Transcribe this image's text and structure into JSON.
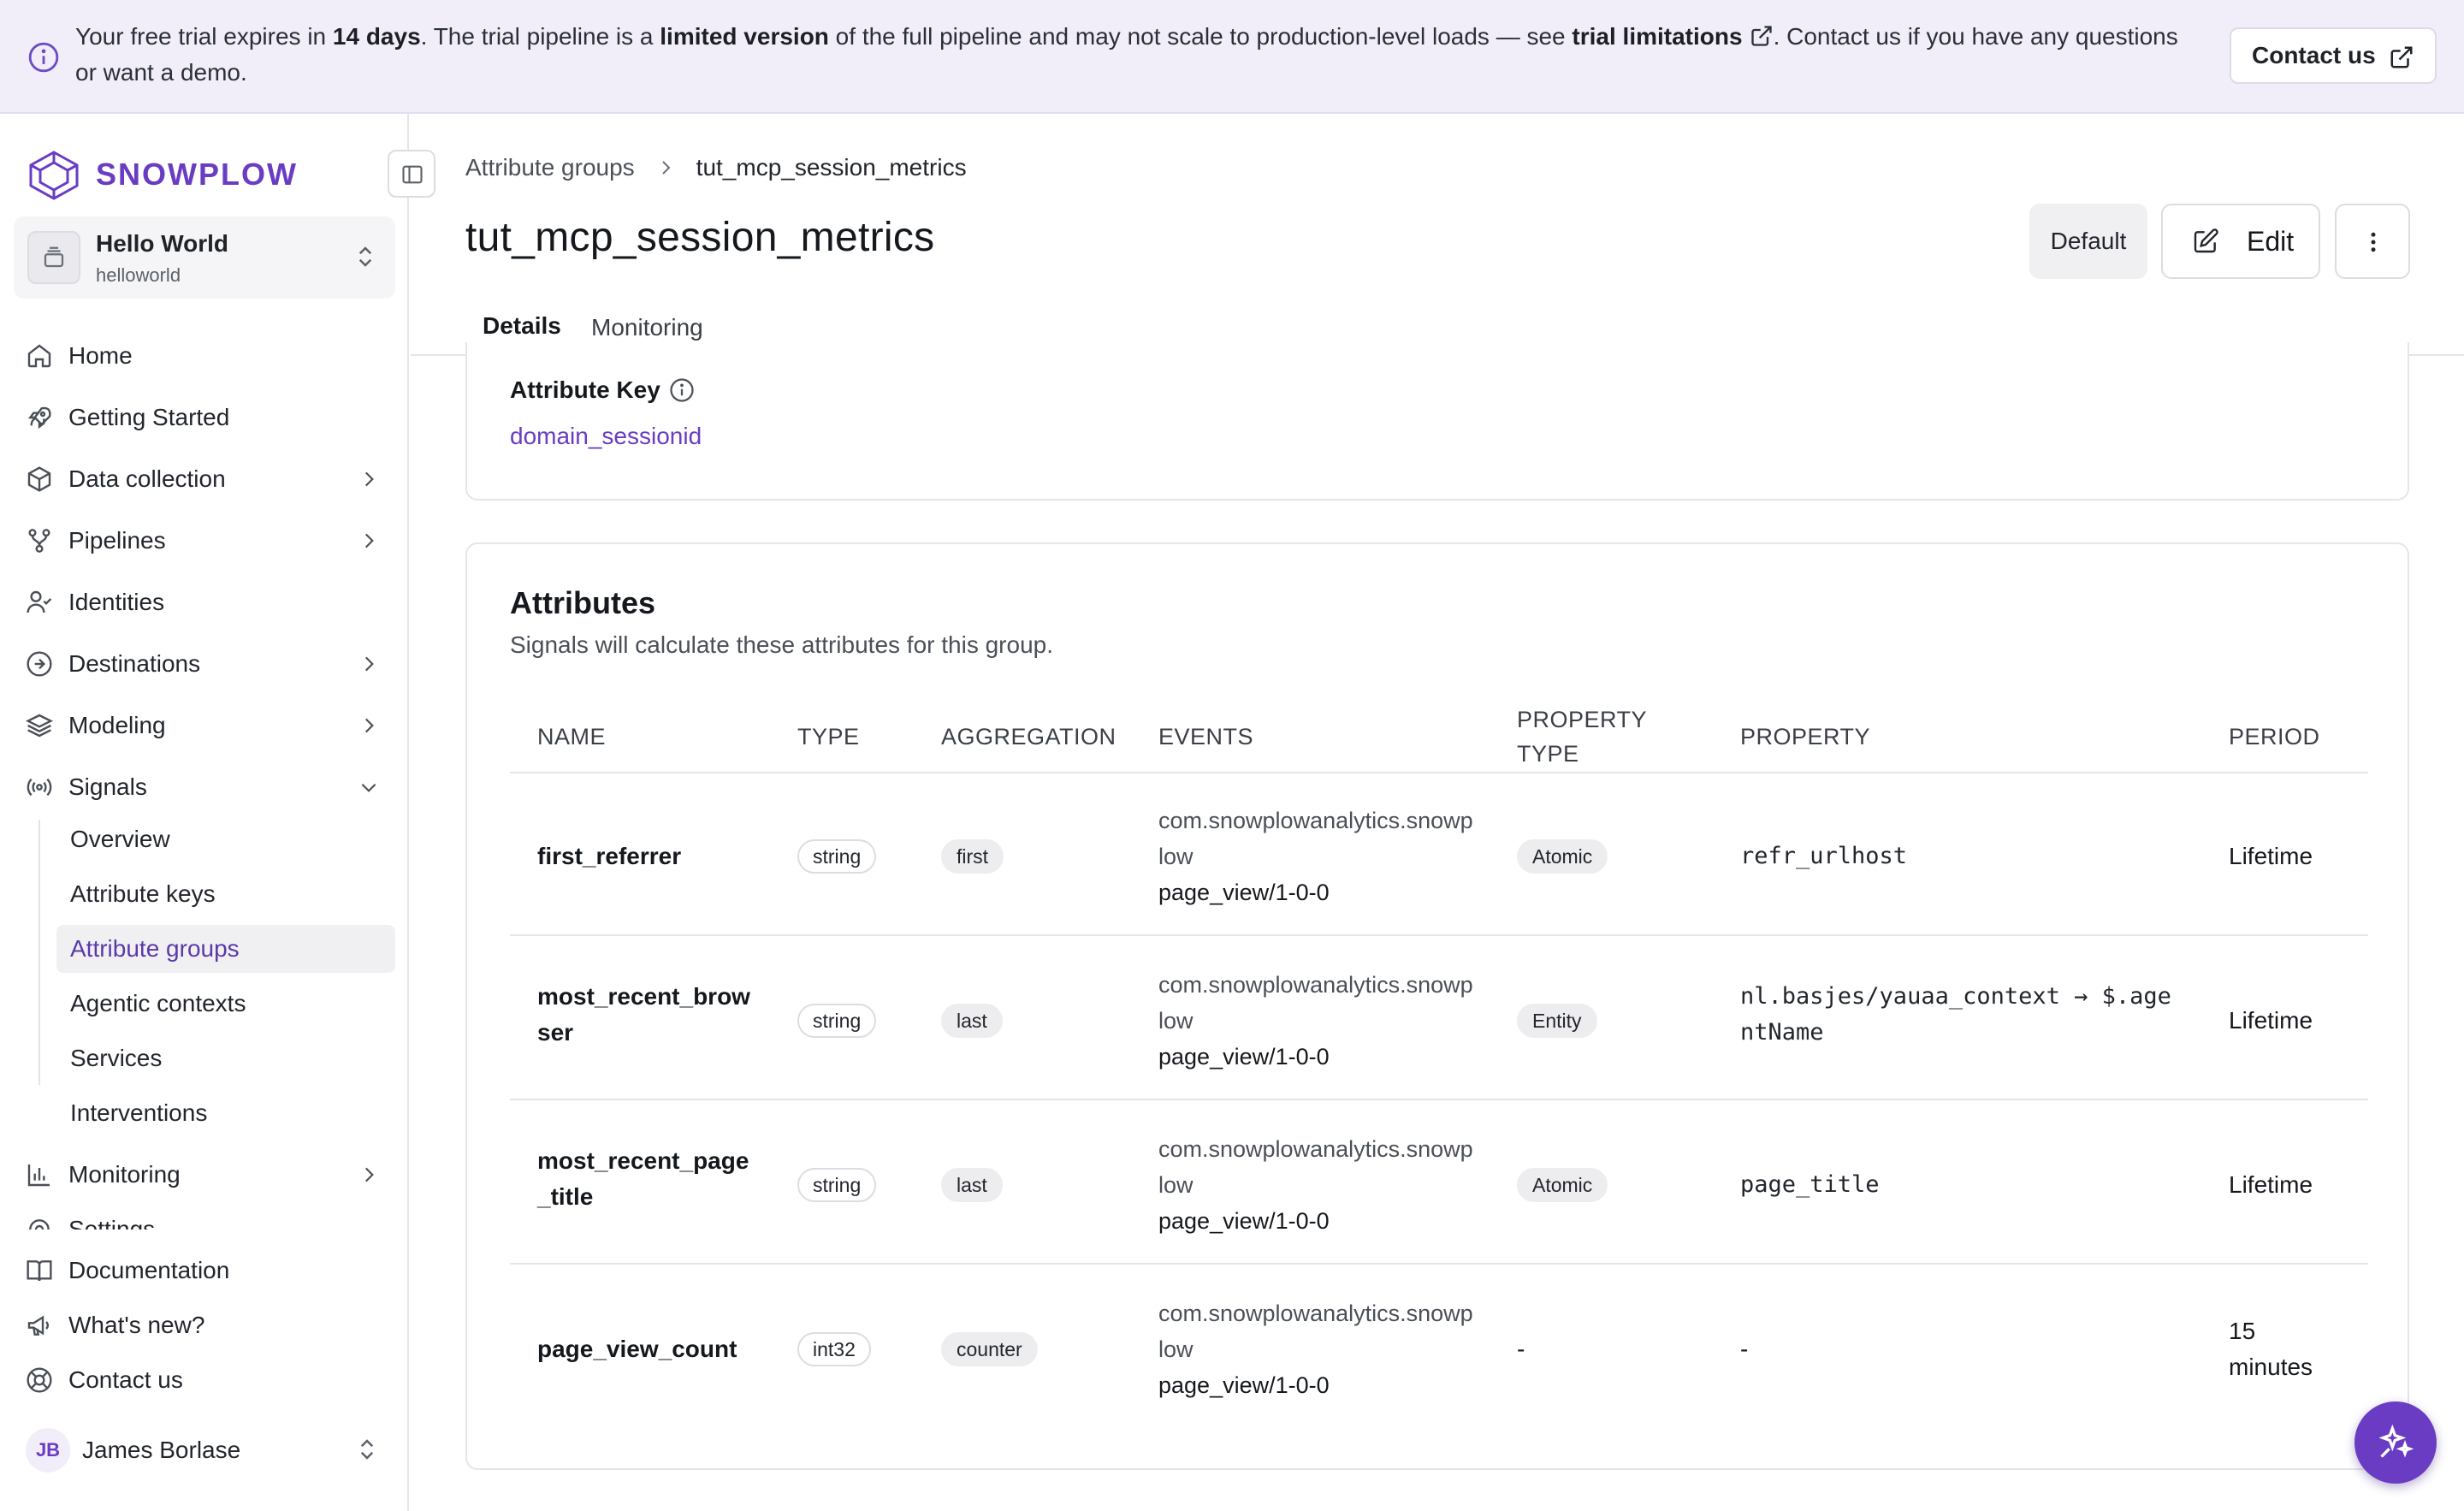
{
  "banner": {
    "t1": "Your free trial expires in ",
    "t2": "14 days",
    "t3": ". The trial pipeline is a ",
    "t4": "limited version",
    "t5": " of the full pipeline and may not scale to production-level loads — see ",
    "t6": "trial limitations",
    "t7": ". Contact us if you have any questions or want a demo.",
    "contact_label": "Contact us"
  },
  "sidebar": {
    "brand": "SNOWPLOW",
    "org_name": "Hello World",
    "org_slug": "helloworld",
    "items": [
      {
        "label": "Home",
        "icon": "home-icon"
      },
      {
        "label": "Getting Started",
        "icon": "rocket-icon"
      },
      {
        "label": "Data collection",
        "icon": "cube-icon"
      },
      {
        "label": "Pipelines",
        "icon": "pipeline-icon"
      },
      {
        "label": "Identities",
        "icon": "user-check-icon"
      },
      {
        "label": "Destinations",
        "icon": "arrow-circle-icon"
      },
      {
        "label": "Modeling",
        "icon": "layers-icon"
      },
      {
        "label": "Signals",
        "icon": "signal-icon"
      }
    ],
    "signals_sub": [
      "Overview",
      "Attribute keys",
      "Attribute groups",
      "Agentic contexts",
      "Services",
      "Interventions"
    ],
    "monitoring": "Monitoring",
    "settings_partial": "Settings",
    "bottom": [
      "Documentation",
      "What's new?",
      "Contact us"
    ],
    "user_initials": "JB",
    "user_name": "James Borlase"
  },
  "header": {
    "breadcrumb_parent": "Attribute groups",
    "breadcrumb_current": "tut_mcp_session_metrics",
    "title": "tut_mcp_session_metrics",
    "default_label": "Default",
    "edit_label": "Edit",
    "tabs": [
      "Details",
      "Monitoring"
    ]
  },
  "key_card": {
    "label": "Attribute Key",
    "value": "domain_sessionid"
  },
  "attributes": {
    "title": "Attributes",
    "subtitle": "Signals will calculate these attributes for this group.",
    "columns": [
      "NAME",
      "TYPE",
      "AGGREGATION",
      "EVENTS",
      "PROPERTY TYPE",
      "PROPERTY",
      "PERIOD"
    ],
    "rows": [
      {
        "name": "first_referrer",
        "type": "string",
        "aggregation": "first",
        "event_vendor": "com.snowplowanalytics.snowplow",
        "event_name": "page_view/1-0-0",
        "property_type": "Atomic",
        "property": "refr_urlhost",
        "period": "Lifetime"
      },
      {
        "name": "most_recent_browser",
        "type": "string",
        "aggregation": "last",
        "event_vendor": "com.snowplowanalytics.snowplow",
        "event_name": "page_view/1-0-0",
        "property_type": "Entity",
        "property": "nl.basjes/yauaa_context → $.agentName",
        "period": "Lifetime"
      },
      {
        "name": "most_recent_page_title",
        "type": "string",
        "aggregation": "last",
        "event_vendor": "com.snowplowanalytics.snowplow",
        "event_name": "page_view/1-0-0",
        "property_type": "Atomic",
        "property": "page_title",
        "period": "Lifetime"
      },
      {
        "name": "page_view_count",
        "type": "int32",
        "aggregation": "counter",
        "event_vendor": "com.snowplowanalytics.snowplow",
        "event_name": "page_view/1-0-0",
        "property_type": "-",
        "property": "-",
        "period": "15 minutes"
      }
    ]
  },
  "colors": {
    "accent": "#6a3cc4",
    "banner_bg": "#f1edf9"
  }
}
